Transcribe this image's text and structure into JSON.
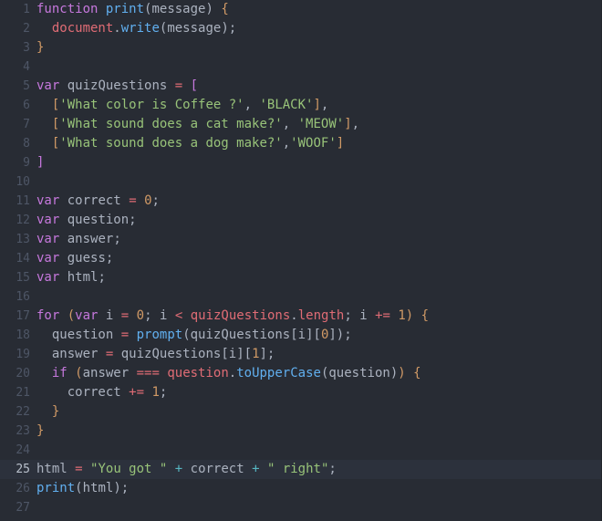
{
  "editor": {
    "theme_name": "One Dark",
    "background": "#282c34",
    "active_line_background": "#2c313c",
    "gutter_color": "#4e5666",
    "active_gutter_color": "#b9c0cc",
    "default_text_color": "#abb2bf",
    "active_line_number": 25,
    "total_lines": 27,
    "language": "JavaScript",
    "colors": {
      "keyword": "#c678dd",
      "function": "#61afef",
      "variable": "#e06c75",
      "string": "#98c379",
      "number": "#d19a66",
      "operator": "#e06c75",
      "concat_operator": "#56b6c2",
      "punctuation": "#abb2bf",
      "brace": "#d19a66"
    },
    "line_numbers": [
      "1",
      "2",
      "3",
      "4",
      "5",
      "6",
      "7",
      "8",
      "9",
      "10",
      "11",
      "12",
      "13",
      "14",
      "15",
      "16",
      "17",
      "18",
      "19",
      "20",
      "21",
      "22",
      "23",
      "24",
      "25",
      "26",
      "27"
    ],
    "lines": [
      {
        "n": "1",
        "text": "function print(message) {"
      },
      {
        "n": "2",
        "text": "  document.write(message);"
      },
      {
        "n": "3",
        "text": "}"
      },
      {
        "n": "4",
        "text": ""
      },
      {
        "n": "5",
        "text": "var quizQuestions = ["
      },
      {
        "n": "6",
        "text": "  ['What color is Coffee ?', 'BLACK'],"
      },
      {
        "n": "7",
        "text": "  ['What sound does a cat make?', 'MEOW'],"
      },
      {
        "n": "8",
        "text": "  ['What sound does a dog make?','WOOF']"
      },
      {
        "n": "9",
        "text": "]"
      },
      {
        "n": "10",
        "text": ""
      },
      {
        "n": "11",
        "text": "var correct = 0;"
      },
      {
        "n": "12",
        "text": "var question;"
      },
      {
        "n": "13",
        "text": "var answer;"
      },
      {
        "n": "14",
        "text": "var guess;"
      },
      {
        "n": "15",
        "text": "var html;"
      },
      {
        "n": "16",
        "text": ""
      },
      {
        "n": "17",
        "text": "for (var i = 0; i < quizQuestions.length; i += 1) {"
      },
      {
        "n": "18",
        "text": "  question = prompt(quizQuestions[i][0]);"
      },
      {
        "n": "19",
        "text": "  answer = quizQuestions[i][1];"
      },
      {
        "n": "20",
        "text": "  if (answer === question.toUpperCase(question)) {"
      },
      {
        "n": "21",
        "text": "    correct += 1;"
      },
      {
        "n": "22",
        "text": "  }"
      },
      {
        "n": "23",
        "text": "}"
      },
      {
        "n": "24",
        "text": ""
      },
      {
        "n": "25",
        "text": "html = \"You got \" + correct + \" right\";"
      },
      {
        "n": "26",
        "text": "print(html);"
      },
      {
        "n": "27",
        "text": ""
      }
    ]
  }
}
